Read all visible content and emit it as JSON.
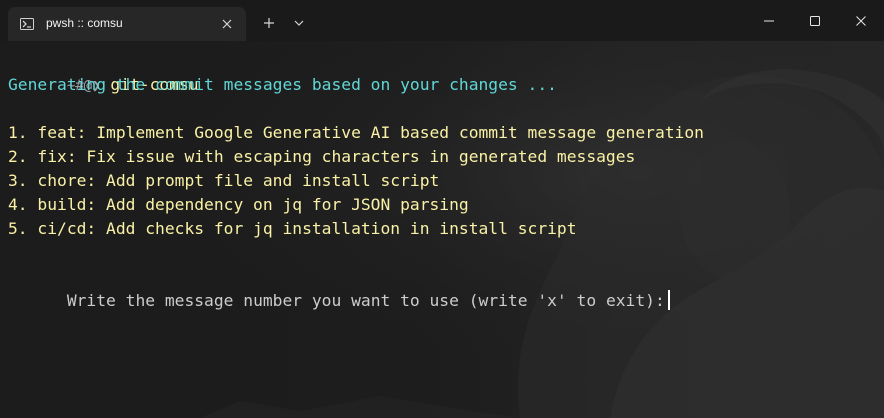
{
  "window": {
    "tab_title": "pwsh :: comsu",
    "tab_icon": "powershell-icon",
    "controls": [
      "minimize-icon",
      "maximize-icon",
      "close-icon"
    ]
  },
  "terminal": {
    "prompt": "~#@❯",
    "command": "git-comsu",
    "status_line": "Generating the commit messages based on your changes ...",
    "messages": [
      "1. feat: Implement Google Generative AI based commit message generation",
      "2. fix: Fix issue with escaping characters in generated messages",
      "3. chore: Add prompt file and install script",
      "4. build: Add dependency on jq for JSON parsing",
      "5. ci/cd: Add checks for jq installation in install script"
    ],
    "input_prompt": "Write the message number you want to use (write 'x' to exit):"
  },
  "colors": {
    "cyan": "#61d6d6",
    "yellow": "#f9f1a5",
    "gray": "#cccccc",
    "background": "#1f1f1f"
  }
}
